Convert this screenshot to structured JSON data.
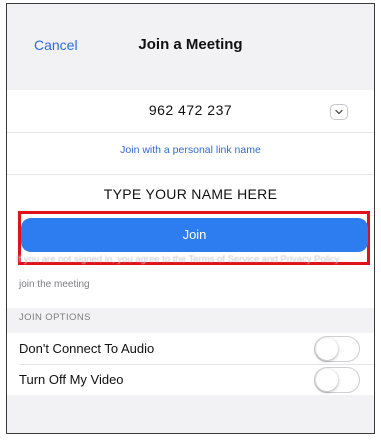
{
  "nav": {
    "cancel_label": "Cancel",
    "title": "Join a Meeting"
  },
  "meeting": {
    "id_value": "962 472 237",
    "dropdown_icon": "chevron-down-icon",
    "personal_link_label": "Join with a personal link name",
    "name_value": "TYPE YOUR NAME HERE"
  },
  "join": {
    "button_label": "Join",
    "terms_text": "If you are not signed in, you agree to the Terms of Service and Privacy Policy",
    "terms_text_tail": "join the meeting"
  },
  "join_options": {
    "header": "JOIN OPTIONS",
    "items": [
      {
        "label": "Don't Connect To Audio",
        "toggled": false
      },
      {
        "label": "Turn Off My Video",
        "toggled": false
      }
    ]
  },
  "colors": {
    "accent": "#2d6be0",
    "join_button": "#2e7df0",
    "highlight_box": "#e0131c",
    "background": "#f2f2f4"
  }
}
